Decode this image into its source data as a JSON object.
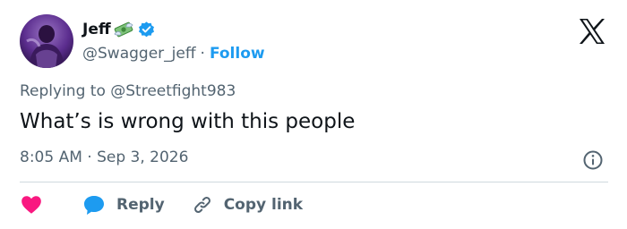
{
  "author": {
    "name": "Jeff",
    "name_emoji": "money-with-wings-icon",
    "verified": true,
    "handle": "@Swagger_jeff",
    "separator": "·",
    "follow_label": "Follow"
  },
  "brand_icon": "x-logo-icon",
  "reply_context": {
    "prefix": "Replying to",
    "mention": "@Streetfight983"
  },
  "tweet": {
    "text": "What’s is wrong with this people",
    "time": "8:05 AM",
    "separator": "·",
    "date": "Sep 3, 2026"
  },
  "actions": {
    "like_icon": "heart-icon",
    "reply_label": "Reply",
    "copy_link_label": "Copy link"
  },
  "colors": {
    "accent": "#1d9bf0",
    "like": "#f91880",
    "text_primary": "#0f1419",
    "text_secondary": "#536471",
    "divider": "#cfd9de",
    "avatar_bg": "#5b2d8e"
  }
}
